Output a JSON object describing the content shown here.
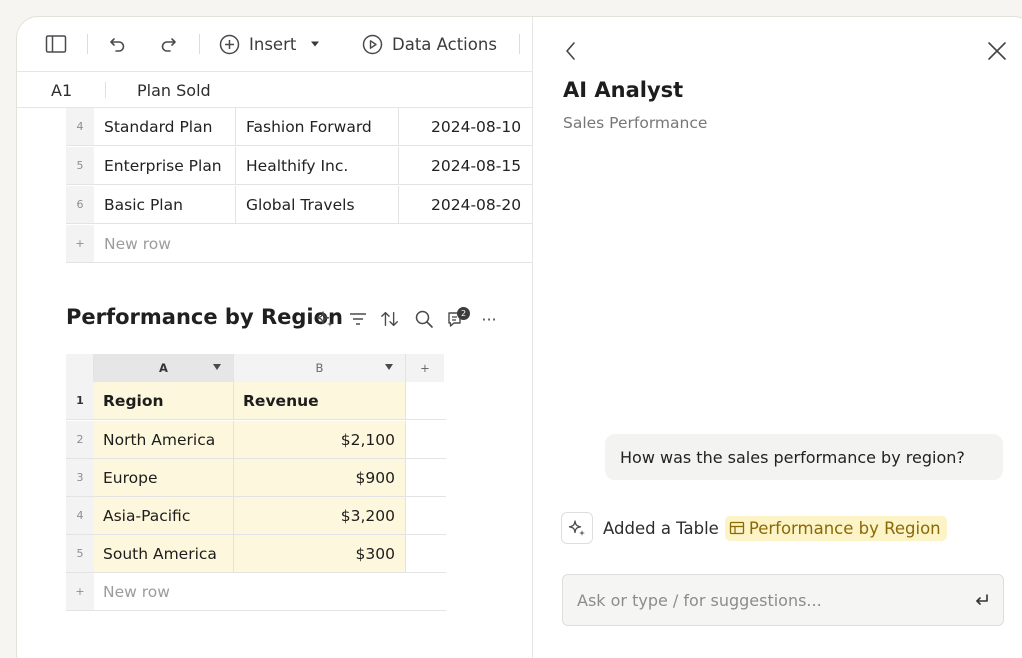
{
  "toolbar": {
    "insert_label": "Insert",
    "data_actions_label": "Data Actions"
  },
  "formula_bar": {
    "cell_ref": "A1",
    "cell_value": "Plan Sold"
  },
  "plans_table": {
    "rows": [
      {
        "num": "4",
        "plan": "Standard Plan",
        "customer": "Fashion Forward",
        "date": "2024-08-10"
      },
      {
        "num": "5",
        "plan": "Enterprise Plan",
        "customer": "Healthify Inc.",
        "date": "2024-08-15"
      },
      {
        "num": "6",
        "plan": "Basic Plan",
        "customer": "Global Travels",
        "date": "2024-08-20"
      }
    ],
    "new_row_symbol": "+",
    "new_row_label": "New row"
  },
  "region_table": {
    "title": "Performance by Region",
    "comment_count": "2",
    "more_label": "···",
    "columns": [
      {
        "letter": "A"
      },
      {
        "letter": "B"
      }
    ],
    "add_column_label": "+",
    "header_row": {
      "num": "1",
      "a": "Region",
      "b": "Revenue"
    },
    "rows": [
      {
        "num": "2",
        "region": "North America",
        "revenue": "$2,100"
      },
      {
        "num": "3",
        "region": "Europe",
        "revenue": "$900"
      },
      {
        "num": "4",
        "region": "Asia-Pacific",
        "revenue": "$3,200"
      },
      {
        "num": "5",
        "region": "South America",
        "revenue": "$300"
      }
    ],
    "new_row_symbol": "+",
    "new_row_label": "New row",
    "highlight_color": "#fdf8dd"
  },
  "ai_panel": {
    "title": "AI Analyst",
    "subtitle": "Sales Performance",
    "user_message": "How was the sales performance by region?",
    "action_text": "Added a Table",
    "action_link": "Performance by Region",
    "input_placeholder": "Ask or type / for suggestions..."
  },
  "icons": [
    "sidebar-toggle-icon",
    "undo-icon",
    "redo-icon",
    "plus-circle-icon",
    "play-circle-icon",
    "sparkle-icon",
    "filter-icon",
    "sort-icon",
    "search-icon",
    "comment-icon",
    "back-chevron-icon",
    "close-icon",
    "table-icon",
    "enter-icon"
  ]
}
